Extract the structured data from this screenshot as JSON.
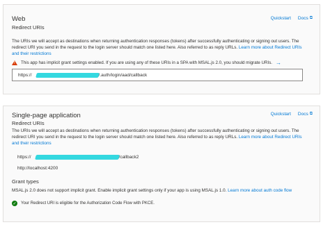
{
  "web": {
    "title": "Web",
    "subtitle": "Redirect URIs",
    "quickstart": "Quickstart",
    "docs": "Docs",
    "description": "The URIs we will accept as destinations when returning authentication responses (tokens) after successfully authenticating or signing out users. The redirect URI you send in the request to the login server should match one listed here. Also referred to as reply URLs.",
    "description_link": "Learn more about Redirect URIs and their restrictions",
    "warning": "This app has implicit grant settings enabled. If you are using any of these URIs in a SPA with MSAL.js 2.0, you should migrate URIs.",
    "uri_prefix": "https://",
    "uri_suffix": "/.auth/login/aad/callback"
  },
  "spa": {
    "title": "Single-page application",
    "subtitle": "Redirect URIs",
    "quickstart": "Quickstart",
    "docs": "Docs",
    "description": "The URIs we will accept as destinations when returning authentication responses (tokens) after successfully authenticating or signing out users. The redirect URI you send in the request to the login server should match one listed here. Also referred to as reply URLs.",
    "description_link": "Learn more about Redirect URIs and their restrictions",
    "uri1_prefix": "https://",
    "uri1_suffix": "/callback2",
    "uri2": "http://localhost:4200",
    "grant_types_label": "Grant types",
    "grant_note": "MSAL.js 2.0 does not support implicit grant. Enable implicit grant settings only if your app is using MSAL.js 1.0.",
    "grant_link": "Learn more about auth code flow",
    "eligible": "Your Redirect URI is eligible for the Authorization Code Flow with PKCE."
  },
  "colors": {
    "link": "#0078d4",
    "warning": "#d83b01",
    "success": "#107c10",
    "redaction": "#34d8e0"
  }
}
